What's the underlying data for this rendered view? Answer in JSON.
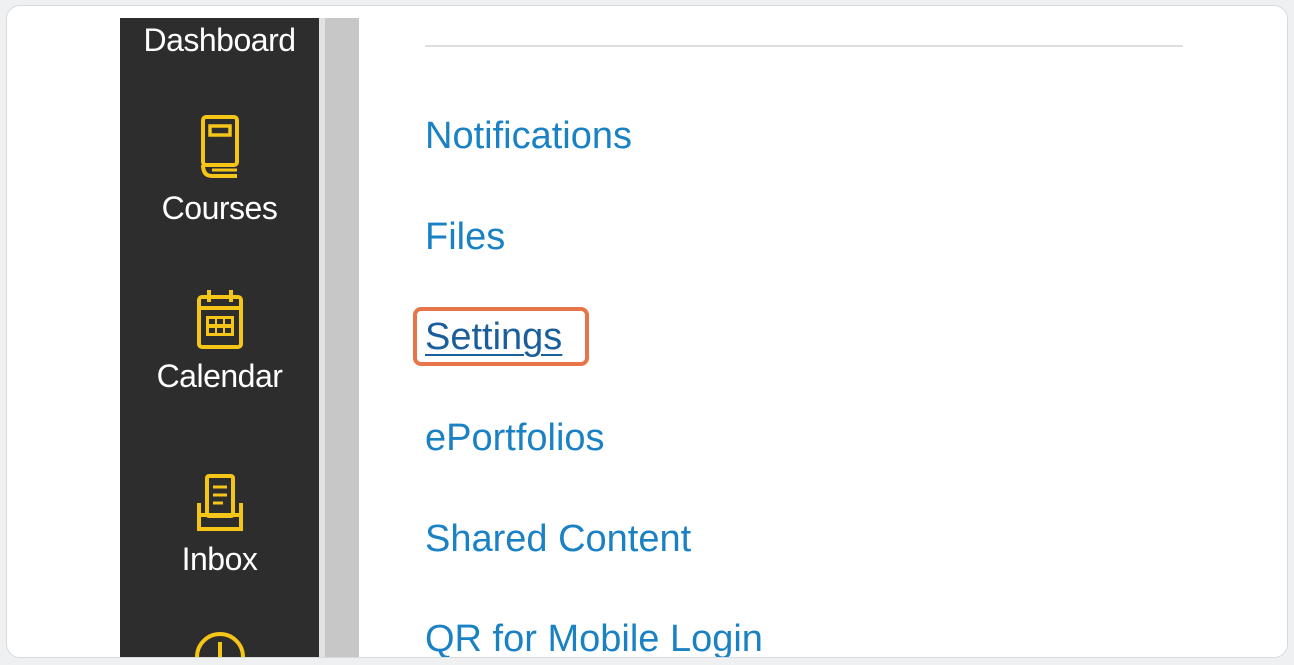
{
  "global_nav": {
    "items": [
      {
        "label": "Dashboard",
        "icon": "dashboard-icon"
      },
      {
        "label": "Courses",
        "icon": "book-icon"
      },
      {
        "label": "Calendar",
        "icon": "calendar-icon"
      },
      {
        "label": "Inbox",
        "icon": "inbox-icon"
      },
      {
        "label": "",
        "icon": "history-icon"
      }
    ],
    "icon_color": "#f5c518",
    "background": "#2d2d2d"
  },
  "account_menu": {
    "items": [
      {
        "label": "Notifications"
      },
      {
        "label": "Files"
      },
      {
        "label": "Settings",
        "highlighted": true
      },
      {
        "label": "ePortfolios"
      },
      {
        "label": "Shared Content"
      },
      {
        "label": "QR for Mobile Login"
      }
    ],
    "link_color": "#1a82c4",
    "highlight_color": "#e8744a"
  }
}
